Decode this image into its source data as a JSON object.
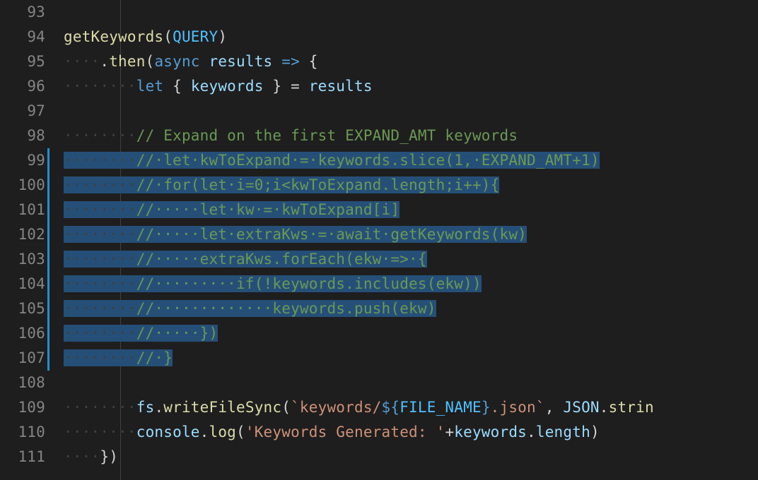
{
  "lineNumbers": [
    "93",
    "94",
    "95",
    "96",
    "97",
    "98",
    "99",
    "100",
    "101",
    "102",
    "103",
    "104",
    "105",
    "106",
    "107",
    "108",
    "109",
    "110",
    "111"
  ],
  "modifiedLines": [
    6,
    7,
    8,
    9,
    10,
    11,
    12,
    13,
    14
  ],
  "indent": {
    "dot": "·",
    "prefix2": "········",
    "prefix3": "············"
  },
  "l93": {
    "text": ""
  },
  "l94": {
    "fn": "getKeywords",
    "lp": "(",
    "arg": "QUERY",
    "rp": ")"
  },
  "l95": {
    "ind": "····",
    "dot": ".",
    "then": "then",
    "lp": "(",
    "async": "async",
    "sp": " ",
    "res": "results",
    "sp2": " ",
    "arrow": "=>",
    "sp3": " ",
    "brace": "{"
  },
  "l96": {
    "ind": "········",
    "let": "let",
    "sp": " ",
    "lb": "{ ",
    "kw": "keywords",
    "rb": " }",
    "sp2": " ",
    "eq": "=",
    "sp3": " ",
    "res": "results"
  },
  "l97": {
    "text": ""
  },
  "l98": {
    "ind": "········",
    "c": "// Expand on the first EXPAND_AMT keywords"
  },
  "l99": {
    "c": "// let kwToExpand = keywords.slice(1, EXPAND_AMT+1)"
  },
  "l100": {
    "c": "// for(let i=0;i<kwToExpand.length;i++){"
  },
  "l101": {
    "c": "//     let kw = kwToExpand[i]"
  },
  "l102": {
    "c": "//     let extraKws = await getKeywords(kw)"
  },
  "l103": {
    "c": "//     extraKws.forEach(ekw => {"
  },
  "l104": {
    "c": "//         if(!keywords.includes(ekw))"
  },
  "l105": {
    "c": "//             keywords.push(ekw)"
  },
  "l106": {
    "c": "//     })"
  },
  "l107": {
    "c": "// }"
  },
  "l108": {
    "text": ""
  },
  "l109": {
    "ind": "········",
    "obj": "fs",
    "dot": ".",
    "fn": "writeFileSync",
    "lp": "(",
    "s1": "`keywords/",
    "tp1": "${",
    "fname": "FILE_NAME",
    "tp2": "}",
    "s2": ".json`",
    "comma": ", ",
    "json": "JSON",
    "dot2": ".",
    "stringify": "strin"
  },
  "l110": {
    "ind": "········",
    "obj": "console",
    "dot": ".",
    "fn": "log",
    "lp": "(",
    "s": "'Keywords Generated: '",
    "plus": "+",
    "kw": "keywords",
    "dot2": ".",
    "len": "length",
    "rp": ")"
  },
  "l111": {
    "ind": "····",
    "close": "})"
  }
}
